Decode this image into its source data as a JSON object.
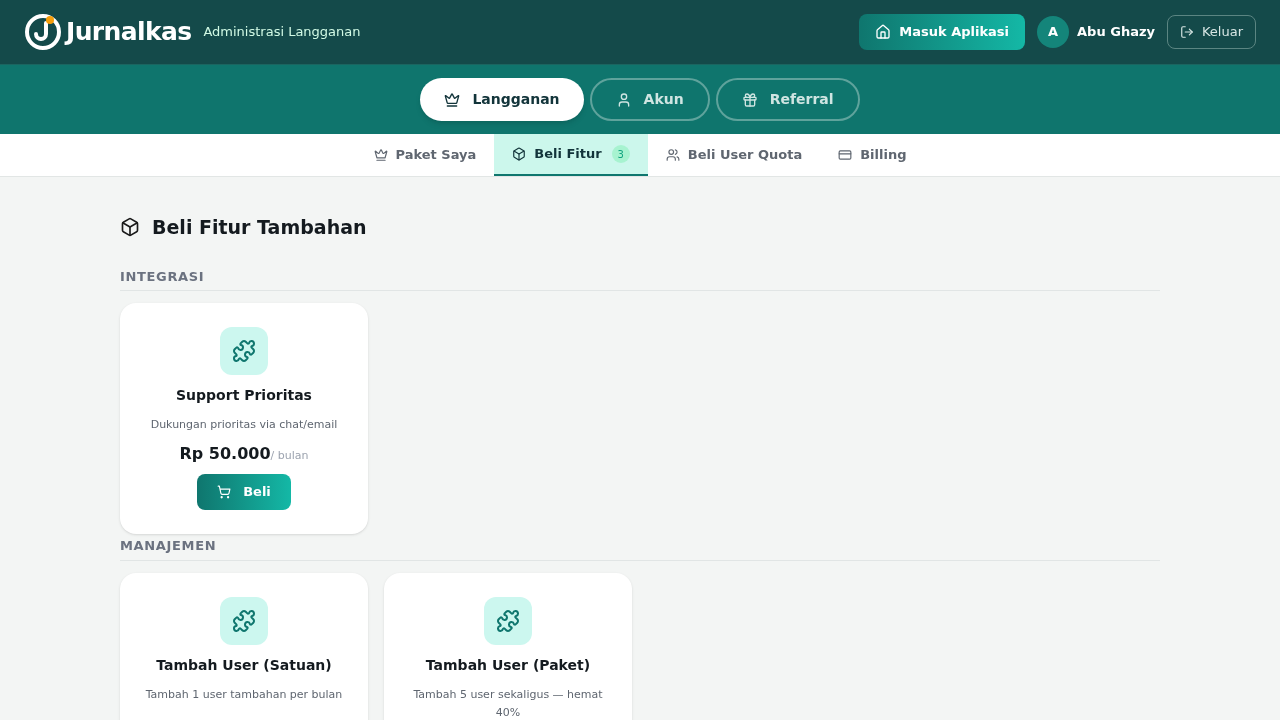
{
  "header": {
    "logo": "Jurnalkas",
    "subtitle": "Administrasi Langganan",
    "enter_button": "Masuk Aplikasi",
    "avatar": "A",
    "user_name": "Abu Ghazy",
    "logout_button": "Keluar"
  },
  "main_tabs": [
    {
      "label": "Langganan",
      "selected": true
    },
    {
      "label": "Akun",
      "selected": false
    },
    {
      "label": "Referral",
      "selected": false
    }
  ],
  "sub_tabs": [
    {
      "label": "Paket Saya",
      "selected": false
    },
    {
      "label": "Beli Fitur",
      "selected": true,
      "badge": "3"
    },
    {
      "label": "Beli User Quota",
      "selected": false
    },
    {
      "label": "Billing",
      "selected": false
    }
  ],
  "page_title": "Beli Fitur Tambahan",
  "sections": [
    {
      "title": "INTEGRASI",
      "items": [
        {
          "name": "Support Prioritas",
          "description": "Dukungan prioritas via chat/email",
          "price": "Rp 50.000",
          "period": "/ bulan",
          "button": "Beli"
        }
      ]
    },
    {
      "title": "MANAJEMEN",
      "items": [
        {
          "name": "Tambah User (Satuan)",
          "description": "Tambah 1 user tambahan per bulan"
        },
        {
          "name": "Tambah User (Paket)",
          "description": "Tambah 5 user sekaligus — hemat 40%"
        }
      ]
    }
  ]
}
